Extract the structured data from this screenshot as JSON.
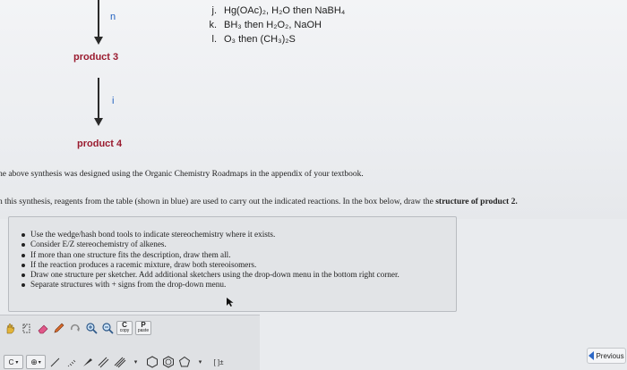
{
  "scheme": {
    "step_n_letter": "n",
    "product3": "product 3",
    "step_i_letter": "i",
    "product4": "product 4",
    "reagents": [
      {
        "key": "j.",
        "text": "Hg(OAc)₂, H₂O then NaBH₄"
      },
      {
        "key": "k.",
        "text": "BH₃ then H₂O₂, NaOH"
      },
      {
        "key": "l.",
        "text": "O₃ then (CH₃)₂S"
      }
    ]
  },
  "intro": {
    "line1": "he above synthesis was designed using the Organic Chemistry Roadmaps in the appendix of your textbook.",
    "line2_prefix": "n this synthesis, reagents from the table (shown in blue) are used to carry out the indicated reactions. In the box below, draw the ",
    "line2_bold": "structure of product 2."
  },
  "instructions": [
    "Use the wedge/hash bond tools to indicate stereochemistry where it exists.",
    "Consider E/Z stereochemistry of alkenes.",
    "If more than one structure fits the description, draw them all.",
    "If the reaction produces a racemic mixture, draw both stereoisomers.",
    "Draw one structure per sketcher. Add additional sketchers using the drop-down menu in the bottom right corner.",
    "Separate structures with + signs from the drop-down menu."
  ],
  "toolbar": {
    "copy_label": "C",
    "copy_sub": "copy",
    "paste_label": "P",
    "paste_sub": "paste",
    "c_dropdown": "C",
    "charge_label": "⊕",
    "bracket_label": "[ ]±"
  },
  "nav": {
    "previous": "Previous"
  },
  "colors": {
    "reagent_letter": "#1f5fbf",
    "product_label": "#9a1b2f"
  }
}
